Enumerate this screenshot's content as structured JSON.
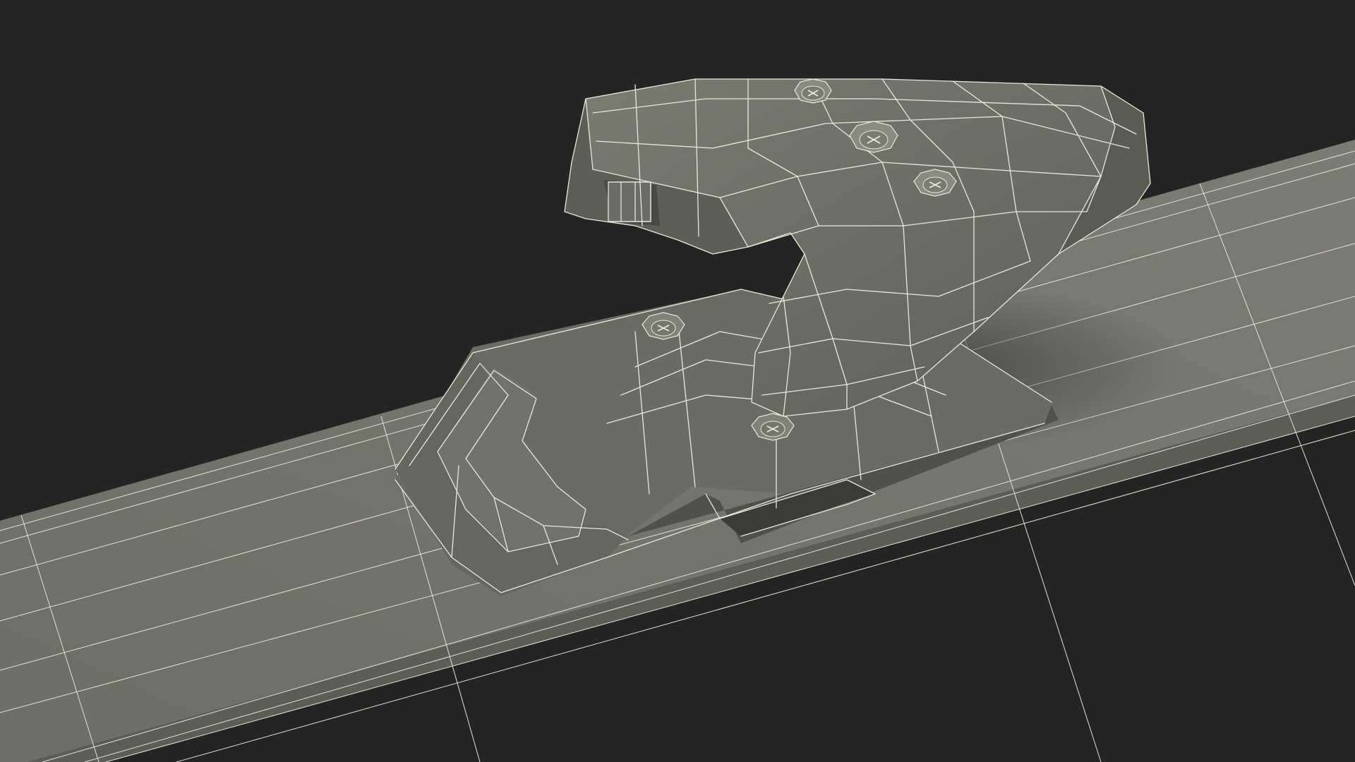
{
  "scene": {
    "subject": "wireframe-3d-render",
    "colors": {
      "background": "#242424",
      "surface_light": "#7c7d73",
      "surface_mid": "#6e6f66",
      "surface_dark": "#55564f",
      "surface_shadow": "#3f403b",
      "wire": "#e8e8da"
    },
    "screw_count": 5
  }
}
